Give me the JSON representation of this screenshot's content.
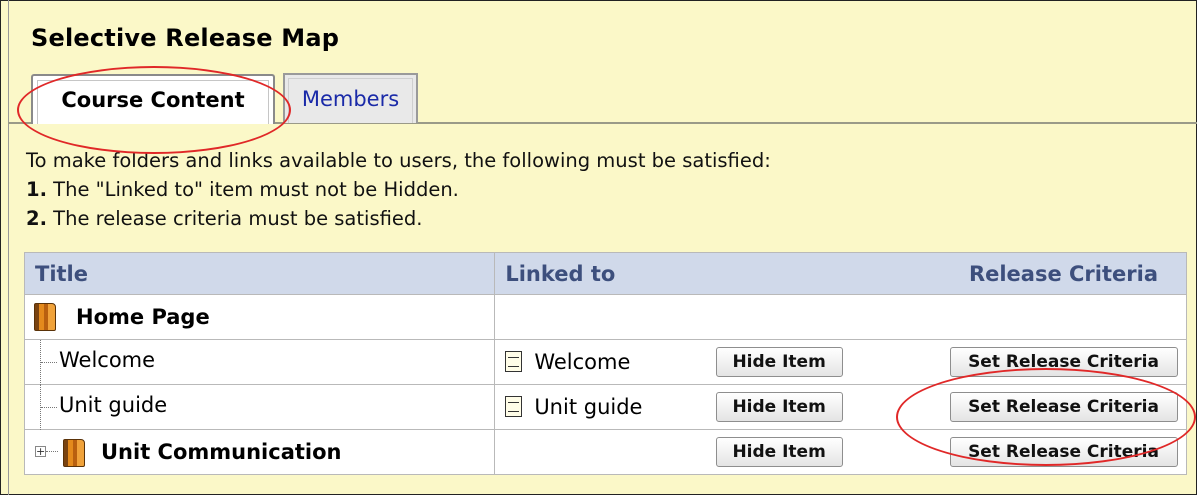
{
  "page": {
    "title": "Selective Release Map"
  },
  "tabs": [
    {
      "label": "Course Content",
      "active": true
    },
    {
      "label": "Members",
      "active": false
    }
  ],
  "instructions": {
    "intro": "To make folders and links available to users, the following must be satisfied:",
    "rule1_num": "1.",
    "rule1_text": " The \"Linked to\" item must not be Hidden.",
    "rule2_num": "2.",
    "rule2_text": " The release criteria must be satisfied."
  },
  "table": {
    "headers": {
      "title": "Title",
      "linked_to": "Linked to",
      "release": "Release Criteria"
    },
    "rows": [
      {
        "title": "Home Page",
        "icon": "folder-book-icon",
        "linked": "",
        "hide": "",
        "release": ""
      },
      {
        "title": "Welcome",
        "icon": "",
        "linked": "Welcome",
        "linked_icon": "document-icon",
        "hide": "Hide Item",
        "release": "Set Release Criteria"
      },
      {
        "title": "Unit guide",
        "icon": "",
        "linked": "Unit guide",
        "linked_icon": "document-icon",
        "hide": "Hide Item",
        "release": "Set Release Criteria"
      },
      {
        "title": "Unit Communication",
        "icon": "folder-book-icon",
        "expand": "+",
        "linked": "",
        "hide": "Hide Item",
        "release": "Set Release Criteria"
      }
    ]
  },
  "annotations": {
    "highlight_color": "#e02828"
  }
}
